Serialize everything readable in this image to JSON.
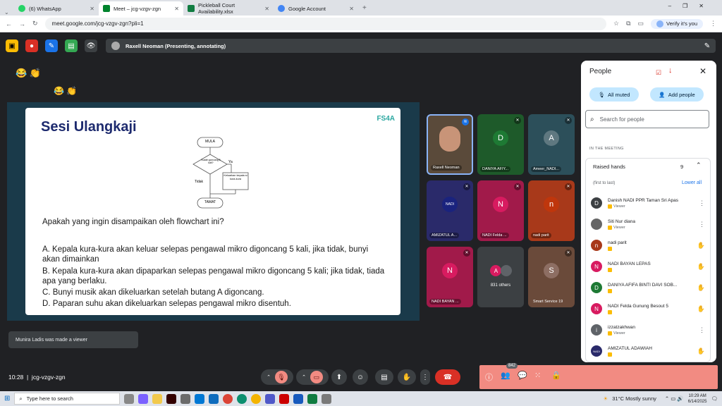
{
  "browser": {
    "tabs": [
      {
        "title": "(6) WhatsApp",
        "color": "#25d366"
      },
      {
        "title": "Meet – jcg-vzgv-zgn",
        "color": "#00832d"
      },
      {
        "title": "Pickleball Court Availability.xlsx",
        "color": "#107c41"
      },
      {
        "title": "Google Account",
        "color": "#4285f4"
      }
    ],
    "url": "meet.google.com/jcg-vzgv-zgn?pli=1",
    "verify": "Verify it's you"
  },
  "meet": {
    "presenting": "Raxell Neoman (Presenting, annotating)",
    "slide": {
      "title": "Sesi Ulangkaji",
      "logo": "FS4A",
      "flow": {
        "start": "MULA",
        "decision": "Sudah goncang 5 kali?",
        "yes": "Ya",
        "no": "Tidak",
        "action": "Keluarkan kepala si kura-kura",
        "end": "TAMAT"
      },
      "question": "Apakah yang ingin disampaikan oleh flowchart ini?",
      "options": [
        "A. Kepala kura-kura  akan keluar selepas pengawal mikro digoncang 5 kali, jika tidak, bunyi akan dimainkan",
        "B. Kepala kura-kura akan dipaparkan selepas pengawal mikro digoncang 5 kali; jika tidak, tiada apa yang berlaku.",
        "C. Bunyi musik akan dikeluarkan setelah butang A digoncang.",
        "D. Paparan suhu akan dikeluarkan selepas pengawal mikro disentuh."
      ]
    },
    "tiles": [
      {
        "name": "Raxell Neoman",
        "letter": "",
        "bg": "#5a4a3a"
      },
      {
        "name": "DANIYA AFIY...",
        "letter": "D",
        "bg": "#1e5a2a"
      },
      {
        "name": "Ameer_NADI...",
        "letter": "A",
        "bg": "#2c4f5a"
      },
      {
        "name": "AMIZATUL A...",
        "letter": "NADI",
        "bg": "#2a2a6a"
      },
      {
        "name": "NADI Felda ...",
        "letter": "N",
        "bg": "#a11a4a"
      },
      {
        "name": "nadi parit",
        "letter": "n",
        "bg": "#a8391a"
      },
      {
        "name": "NADI BAYAN ...",
        "letter": "N",
        "bg": "#a11a4a"
      },
      {
        "name": "831 others",
        "letter": "A",
        "bg": "#3c4043"
      },
      {
        "name": "Smart Service 19",
        "letter": "S",
        "bg": "#6a4a3a"
      }
    ],
    "toast": "Munira Ladis was made a viewer",
    "time_code": "10:28  |  jcg-vzgv-zgn",
    "people_count_badge": "842"
  },
  "people": {
    "title": "People",
    "all_muted": "All muted",
    "add_people": "Add people",
    "search_placeholder": "Search for people",
    "section": "IN THE MEETING",
    "raised_hands": "Raised hands",
    "raised_count": "9",
    "order": "(first to last)",
    "lower_all": "Lower all",
    "list": [
      {
        "name": "Danish NADI PPR Taman Sri Apas",
        "role": "Viewer",
        "letter": "D",
        "color": "#3c4043",
        "action": "more"
      },
      {
        "name": "Siti Nur diana",
        "role": "Viewer",
        "letter": "",
        "color": "#666",
        "action": "more"
      },
      {
        "name": "nadi parit",
        "role": "",
        "letter": "n",
        "color": "#a8391a",
        "action": "hand"
      },
      {
        "name": "NADI BAYAN LEPAS",
        "role": "",
        "letter": "N",
        "color": "#d81b60",
        "action": "hand"
      },
      {
        "name": "DANIYA AFIFA BINTI DAVI SOB...",
        "role": "",
        "letter": "D",
        "color": "#1e7a34",
        "action": "hand"
      },
      {
        "name": "NADI Felda Gunung Besout 5",
        "role": "",
        "letter": "N",
        "color": "#d81b60",
        "action": "hand"
      },
      {
        "name": "izzatzakhwan",
        "role": "Viewer",
        "letter": "i",
        "color": "#5f6368",
        "action": "more"
      },
      {
        "name": "AMIZATUL ADAWIAH",
        "role": "",
        "letter": "NADI",
        "color": "#2a2a6a",
        "action": "hand"
      }
    ]
  },
  "taskbar": {
    "search": "Type here to search",
    "weather": "31°C  Mostly sunny",
    "time": "10:29 AM",
    "date": "6/14/2025"
  }
}
